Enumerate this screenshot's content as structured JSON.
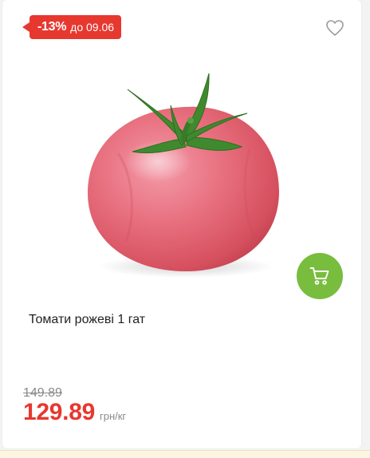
{
  "badge": {
    "discount": "-13%",
    "until": "до 09.06",
    "color": "#e7382f"
  },
  "icons": {
    "favorite": "heart-outline-icon",
    "cart": "shopping-cart-icon"
  },
  "product": {
    "title": "Томати рожеві 1 гат",
    "old_price": "149.89",
    "price": "129.89",
    "unit": "грн/кг"
  },
  "colors": {
    "accent_red": "#e7382f",
    "cart_green": "#78bd3e"
  }
}
